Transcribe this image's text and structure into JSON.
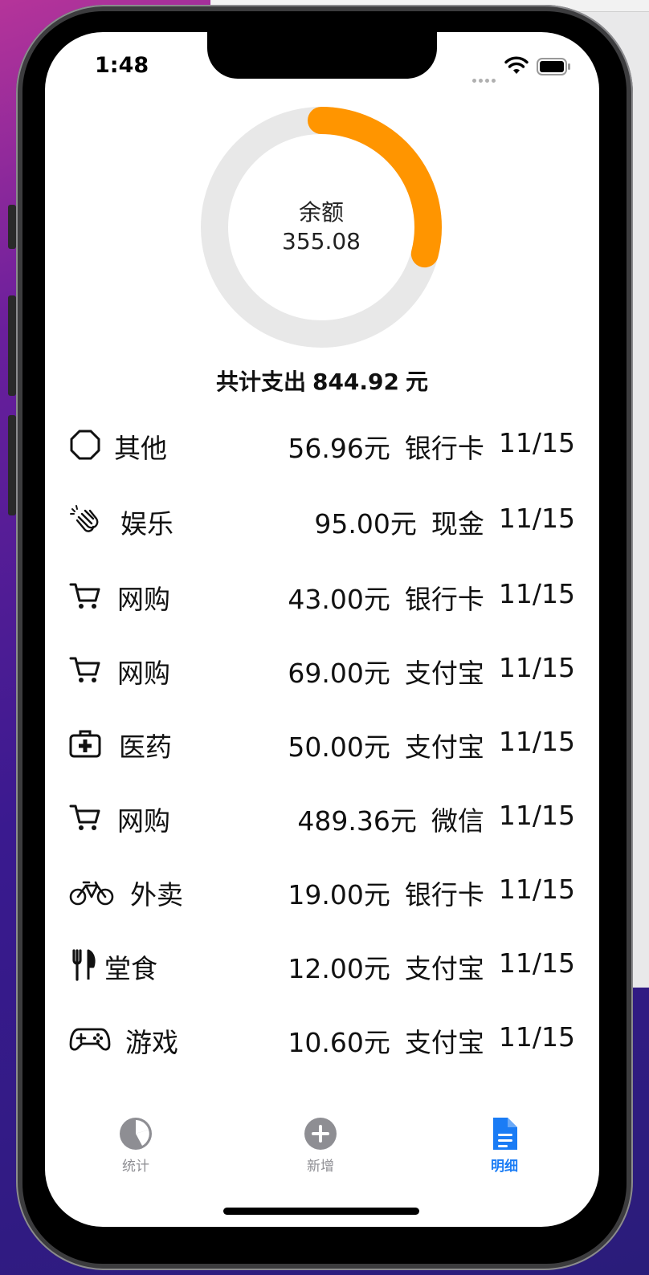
{
  "status_bar": {
    "time": "1:48"
  },
  "summary": {
    "balance_label": "余额",
    "balance_value": "355.08",
    "total_prefix": "共计支出",
    "total_amount": "844.92",
    "total_unit": "元",
    "spent_fraction": 0.29,
    "ring_track_color": "#e8e8e8",
    "ring_fill_color": "#ff9500"
  },
  "transactions": [
    {
      "icon": "octagon-icon",
      "category": "其他",
      "amount": "56.96元",
      "method": "银行卡",
      "date": "11/15"
    },
    {
      "icon": "clapping-hands-icon",
      "category": "娱乐",
      "amount": "95.00元",
      "method": "现金",
      "date": "11/15"
    },
    {
      "icon": "cart-icon",
      "category": "网购",
      "amount": "43.00元",
      "method": "银行卡",
      "date": "11/15"
    },
    {
      "icon": "cart-icon",
      "category": "网购",
      "amount": "69.00元",
      "method": "支付宝",
      "date": "11/15"
    },
    {
      "icon": "medical-kit-icon",
      "category": "医药",
      "amount": "50.00元",
      "method": "支付宝",
      "date": "11/15"
    },
    {
      "icon": "cart-icon",
      "category": "网购",
      "amount": "489.36元",
      "method": "微信",
      "date": "11/15"
    },
    {
      "icon": "bicycle-icon",
      "category": "外卖",
      "amount": "19.00元",
      "method": "银行卡",
      "date": "11/15"
    },
    {
      "icon": "fork-knife-icon",
      "category": "堂食",
      "amount": "12.00元",
      "method": "支付宝",
      "date": "11/15"
    },
    {
      "icon": "gamecontroller-icon",
      "category": "游戏",
      "amount": "10.60元",
      "method": "支付宝",
      "date": "11/15"
    }
  ],
  "tabs": [
    {
      "label": "统计",
      "icon": "pie-chart-icon",
      "active": false
    },
    {
      "label": "新增",
      "icon": "plus-circle-icon",
      "active": false
    },
    {
      "label": "明细",
      "icon": "document-icon",
      "active": true
    }
  ],
  "colors": {
    "accent": "#1a7cf5",
    "inactive": "#8e8e93"
  }
}
